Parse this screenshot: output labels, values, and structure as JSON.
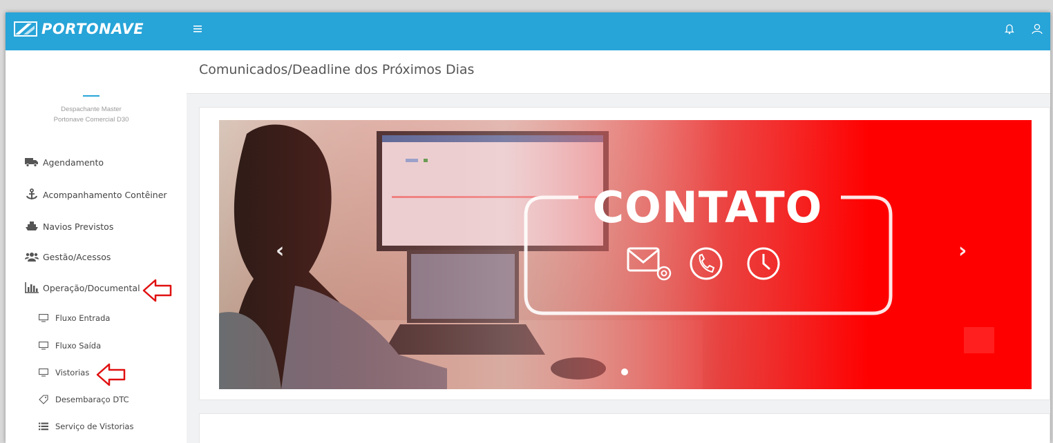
{
  "header": {
    "logo_text": "PORTONAVE",
    "menu_icon": "hamburger-icon",
    "notification_icon": "bell-icon",
    "user_icon": "user-icon",
    "accent": "#27a4d8"
  },
  "profile": {
    "role": "Despachante Master",
    "company": "Portonave Comercial D30"
  },
  "sidebar": {
    "items": [
      {
        "label": "Agendamento",
        "icon": "truck-icon"
      },
      {
        "label": "Acompanhamento Contêiner",
        "icon": "anchor-icon"
      },
      {
        "label": "Navios Previstos",
        "icon": "ship-icon"
      },
      {
        "label": "Gestão/Acessos",
        "icon": "users-icon"
      },
      {
        "label": "Operação/Documental",
        "icon": "bar-chart-icon"
      }
    ],
    "subitems": [
      {
        "label": "Fluxo Entrada",
        "icon": "monitor-icon"
      },
      {
        "label": "Fluxo Saída",
        "icon": "monitor-icon"
      },
      {
        "label": "Vistorias",
        "icon": "monitor-icon"
      },
      {
        "label": "Desembaraço DTC",
        "icon": "tag-icon"
      },
      {
        "label": "Serviço de Vistorias",
        "icon": "list-icon"
      }
    ]
  },
  "main": {
    "title": "Comunicados/Deadline dos Próximos Dias",
    "banner": {
      "text": "CONTATO",
      "icons": [
        "email-icon",
        "phone-icon",
        "clock-icon"
      ],
      "accent": "#ff0000"
    },
    "prev_arrow": "‹",
    "next_arrow": "›"
  }
}
